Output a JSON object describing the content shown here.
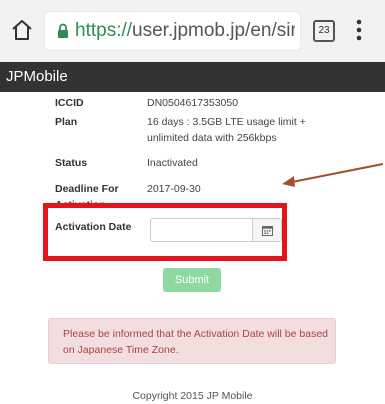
{
  "browser": {
    "url_scheme": "https://",
    "url_rest": "user.jpmob.jp/en/sim/sl",
    "tab_count": "23"
  },
  "site": {
    "title": "JPMobile"
  },
  "details": {
    "iccid_label": "ICCID",
    "iccid_value": "DN0504617353050",
    "plan_label": "Plan",
    "plan_value": "16 days : 3.5GB LTE usage limit + unlimited data with 256kbps",
    "status_label": "Status",
    "status_value": "Inactivated",
    "deadline_label": "Deadline For Activation",
    "deadline_value": "2017-09-30"
  },
  "activation": {
    "label": "Activation Date",
    "value": ""
  },
  "form": {
    "submit_label": "Submit"
  },
  "notice": {
    "text": "Please be informed that the Activation Date will be based on Japanese Time Zone."
  },
  "footer": {
    "copyright": "Copyright 2015 JP Mobile"
  },
  "colors": {
    "annotation": "#e0161c",
    "arrow": "#a0522d",
    "header_bg": "#333333",
    "submit_bg": "#8fd8a0",
    "notice_bg": "#f2dede"
  },
  "icons": [
    "home-icon",
    "lock-icon",
    "tab-switcher-icon",
    "menu-icon",
    "calendar-icon"
  ]
}
